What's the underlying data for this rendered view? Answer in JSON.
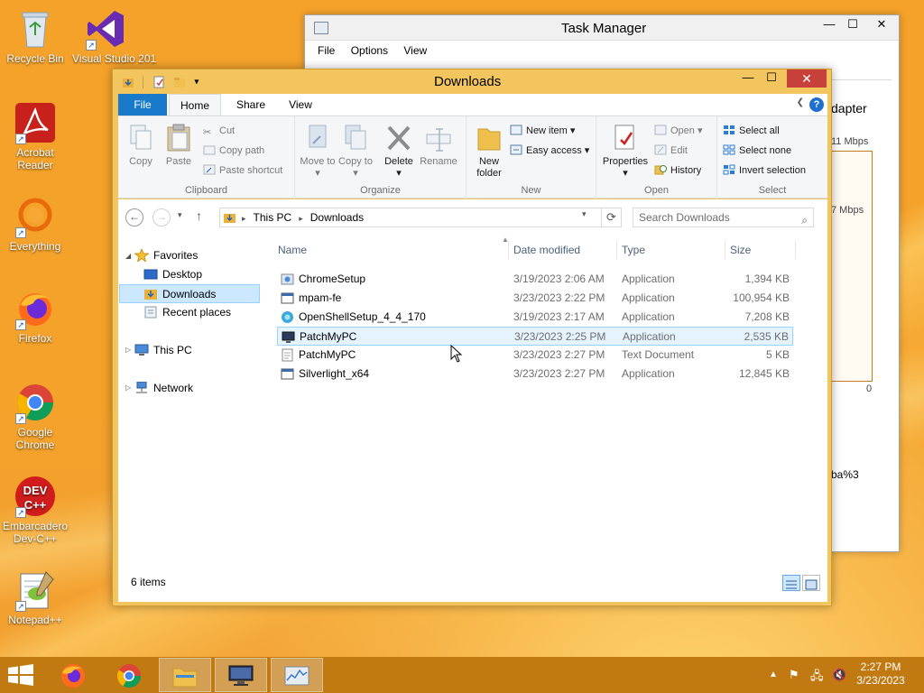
{
  "desktop": {
    "icons": [
      {
        "label": "Recycle Bin"
      },
      {
        "label": "Visual Studio 201"
      },
      {
        "label": "Acrobat Reader"
      },
      {
        "label": "Everything"
      },
      {
        "label": "Firefox"
      },
      {
        "label": "Google Chrome"
      },
      {
        "label": "Embarcadero Dev-C++"
      },
      {
        "label": "Notepad++"
      }
    ]
  },
  "taskmgr": {
    "title": "Task Manager",
    "menu": [
      "File",
      "Options",
      "View"
    ],
    "adapter_label": "dapter",
    "speed_top": "11 Mbps",
    "speed_mid": "7 Mbps",
    "zero": "0",
    "bottom_text": "ba%3"
  },
  "explorer": {
    "title": "Downloads",
    "tabs": {
      "file": "File",
      "home": "Home",
      "share": "Share",
      "view": "View"
    },
    "ribbon": {
      "clipboard": {
        "label": "Clipboard",
        "copy": "Copy",
        "paste": "Paste",
        "cut": "Cut",
        "copy_path": "Copy path",
        "paste_shortcut": "Paste shortcut"
      },
      "organize": {
        "label": "Organize",
        "move_to": "Move to",
        "copy_to": "Copy to",
        "delete": "Delete",
        "rename": "Rename"
      },
      "new": {
        "label": "New",
        "new_folder": "New folder",
        "new_item": "New item",
        "easy_access": "Easy access"
      },
      "open": {
        "label": "Open",
        "properties": "Properties",
        "open": "Open",
        "edit": "Edit",
        "history": "History"
      },
      "select": {
        "label": "Select",
        "select_all": "Select all",
        "select_none": "Select none",
        "invert": "Invert selection"
      }
    },
    "address": {
      "crumbs": [
        "This PC",
        "Downloads"
      ]
    },
    "search": {
      "placeholder": "Search Downloads"
    },
    "nav": {
      "favorites": "Favorites",
      "desktop": "Desktop",
      "downloads": "Downloads",
      "recent": "Recent places",
      "thispc": "This PC",
      "network": "Network"
    },
    "columns": {
      "name": "Name",
      "date": "Date modified",
      "type": "Type",
      "size": "Size"
    },
    "files": [
      {
        "name": "ChromeSetup",
        "date": "3/19/2023 2:06 AM",
        "type": "Application",
        "size": "1,394 KB"
      },
      {
        "name": "mpam-fe",
        "date": "3/23/2023 2:22 PM",
        "type": "Application",
        "size": "100,954 KB"
      },
      {
        "name": "OpenShellSetup_4_4_170",
        "date": "3/19/2023 2:17 AM",
        "type": "Application",
        "size": "7,208 KB"
      },
      {
        "name": "PatchMyPC",
        "date": "3/23/2023 2:25 PM",
        "type": "Application",
        "size": "2,535 KB"
      },
      {
        "name": "PatchMyPC",
        "date": "3/23/2023 2:27 PM",
        "type": "Text Document",
        "size": "5 KB"
      },
      {
        "name": "Silverlight_x64",
        "date": "3/23/2023 2:27 PM",
        "type": "Application",
        "size": "12,845 KB"
      }
    ],
    "status": "6 items"
  },
  "taskbar": {
    "time": "2:27 PM",
    "date": "3/23/2023"
  },
  "colors": {
    "accent": "#1979ca",
    "close": "#c7413a",
    "selection": "#cce8ff"
  }
}
